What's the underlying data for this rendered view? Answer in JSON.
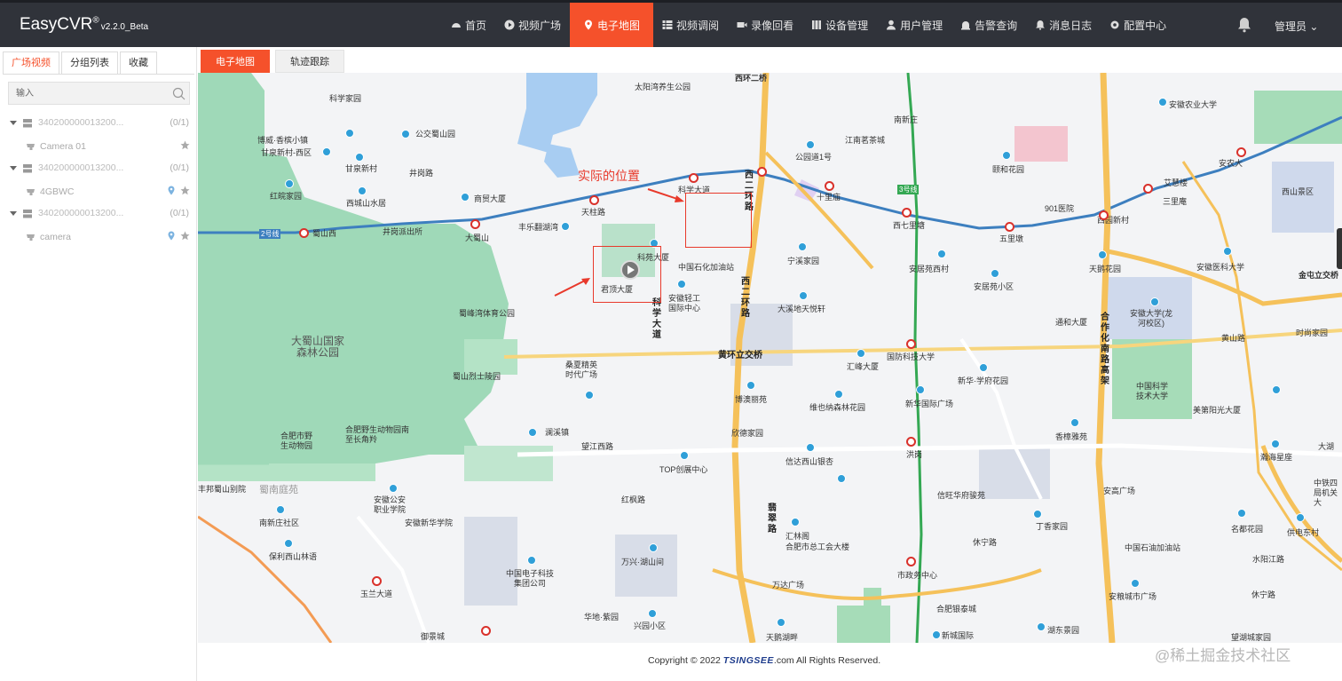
{
  "app": {
    "title": "EasyCVR",
    "reg": "®",
    "version": "v2.2.0_Beta"
  },
  "nav": {
    "items": [
      {
        "label": "首页",
        "icon": "dashboard-icon"
      },
      {
        "label": "视频广场",
        "icon": "play-circle-icon"
      },
      {
        "label": "电子地图",
        "icon": "map-pin-icon",
        "active": true
      },
      {
        "label": "视频调阅",
        "icon": "grid-icon"
      },
      {
        "label": "录像回看",
        "icon": "video-camera-icon"
      },
      {
        "label": "设备管理",
        "icon": "device-icon"
      },
      {
        "label": "用户管理",
        "icon": "user-icon"
      },
      {
        "label": "告警查询",
        "icon": "alarm-icon"
      },
      {
        "label": "消息日志",
        "icon": "bell-icon"
      },
      {
        "label": "配置中心",
        "icon": "gear-icon"
      }
    ],
    "admin": "管理员 ⌄"
  },
  "sidebar": {
    "tabs": [
      "广场视频",
      "分组列表",
      "收藏"
    ],
    "search_placeholder": "输入",
    "tree": [
      {
        "id": "340200000013200...",
        "count": "(0/1)",
        "camera": "Camera 01",
        "has_pin": false
      },
      {
        "id": "340200000013200...",
        "count": "(0/1)",
        "camera": "4GBWC",
        "has_pin": true
      },
      {
        "id": "340200000013200...",
        "count": "(0/1)",
        "camera": "camera",
        "has_pin": true
      }
    ]
  },
  "main": {
    "tabs": [
      "电子地图",
      "轨迹跟踪"
    ]
  },
  "map": {
    "annotation": "实际的位置",
    "labels": {
      "a1": "太阳湾养生公园",
      "a2": "西环二桥",
      "a3": "科学家园",
      "a4": "公交蜀山园",
      "a5": "博威·香槟小镇",
      "a6": "甘泉新村-西区",
      "a7": "甘泉新村",
      "a8": "井岗路",
      "a9": "红皖家园",
      "a10": "西城山水居",
      "a11": "商贸大厦",
      "a12": "天柱路",
      "a13": "科学大道",
      "a14": "丰乐翻湖湾",
      "a15": "蜀山西",
      "a16": "2号线",
      "a17": "井岗派出所",
      "a18": "大蜀山",
      "a19": "科苑大厦",
      "a20": "君顶大厦",
      "a21": "中国石化加油站",
      "a22": "安徽轻工国际中心",
      "a23": "科学大道",
      "a24": "蜀峰湾体育公园",
      "a25": "大蜀山国家森林公园",
      "a26": "蜀山烈士陵园",
      "a27": "桑夏精英时代广场",
      "a28": "黄环立交桥",
      "a29": "合肥市野生动物园",
      "a30": "合肥野生动物园南至长角羚",
      "a31": "澜溪镇",
      "a32": "望江西路",
      "a33": "TOP创展中心",
      "a34": "红枫路",
      "a35": "蜀南庭苑",
      "a36": "安徽公安职业学院",
      "a37": "安徽新华学院",
      "a38": "南新庄社区",
      "a39": "保利西山林语",
      "a40": "万兴·湖山间",
      "a41": "中国电子科技集团公司",
      "a42": "华地·紫园",
      "a43": "兴园小区",
      "a44": "玉兰大道",
      "a45": "御景城",
      "a46": "西二环路",
      "a47": "南新庄",
      "a48": "江南茗茶城",
      "a49": "公园道1号",
      "a50": "十里庙",
      "a51": "宁溪家园",
      "a52": "安居苑西村",
      "a53": "安居苑小区",
      "a54": "大溪地天悦轩",
      "a55": "汇峰大厦",
      "a56": "国防科技大学",
      "a57": "博澳丽苑",
      "a58": "维也纳森林花园",
      "a59": "新华国际广场",
      "a60": "欣德家园",
      "a61": "信达西山银杏",
      "a62": "信旺华府骏苑",
      "a63": "汇林阁",
      "a64": "合肥市总工会大楼",
      "a65": "休宁路",
      "a66": "万达广场",
      "a67": "市政务中心",
      "a68": "天鹅湖畔",
      "a69": "新城国际",
      "a70": "合肥银泰城",
      "a71": "湖东景园",
      "a72": "颐和花园",
      "a73": "901医院",
      "a74": "西七里塘",
      "a75": "五里墩",
      "a76": "西园新村",
      "a77": "安徽农业大学",
      "a78": "安农大",
      "a79": "艾慧楼",
      "a80": "三里庵",
      "a81": "西山景区",
      "a82": "天鹅花园",
      "a83": "安徽医科大学",
      "a84": "金屯立交桥",
      "a85": "安徽大学(龙河校区)",
      "a86": "时尚家园",
      "a87": "黄山路",
      "a88": "通和大厦",
      "a89": "新华·学府花园",
      "a90": "中国科学技术大学",
      "a91": "美第阳光大厦",
      "a92": "香樟雅苑",
      "a93": "瀚海星座",
      "a94": "丁香家园",
      "a95": "安高广场",
      "a96": "中国石油加油站",
      "a97": "名都花园",
      "a98": "水阳江路",
      "a99": "安粮城市广场",
      "a100": "望湖城家园",
      "a101": "合作化南路高架",
      "a102": "洪岗",
      "a103": "3号线",
      "a104": "中铁四局机关大",
      "a105": "供电东村",
      "a106": "丰邦蜀山别院",
      "a107": "大湖",
      "a108": "休宁路",
      "a109": "翡翠路",
      "a110": "西二环路"
    }
  },
  "footer": {
    "copyright_pre": "Copyright © 2022 ",
    "brand": "TSINGSEE",
    "copyright_post": ".com All Rights Reserved.",
    "watermark": "@稀土掘金技术社区"
  },
  "colors": {
    "accent": "#f5512b",
    "topbar": "#30333a",
    "annotation": "#e8392b"
  }
}
